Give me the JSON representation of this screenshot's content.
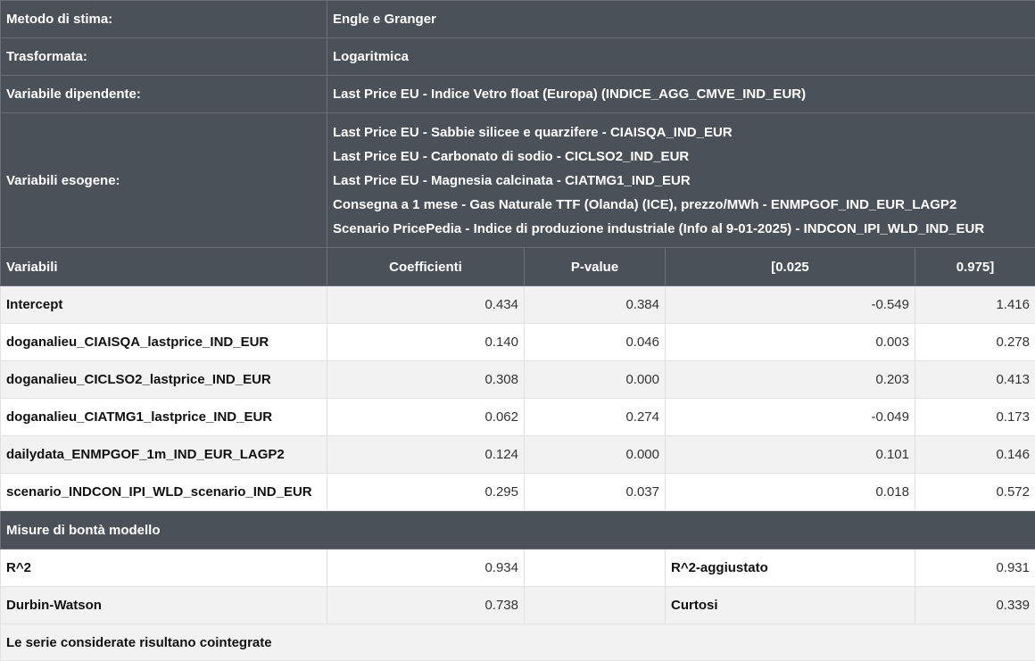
{
  "info": {
    "method": {
      "label": "Metodo di stima:",
      "value": "Engle e Granger"
    },
    "transform": {
      "label": "Trasformata:",
      "value": "Logaritmica"
    },
    "dependent": {
      "label": "Variabile dipendente:",
      "value": "Last Price EU - Indice Vetro float (Europa) (INDICE_AGG_CMVE_IND_EUR)"
    },
    "exogenous": {
      "label": "Variabili esogene:",
      "values": [
        "Last Price EU - Sabbie silicee e quarzifere - CIAISQA_IND_EUR",
        "Last Price EU - Carbonato di sodio - CICLSO2_IND_EUR",
        "Last Price EU - Magnesia calcinata - CIATMG1_IND_EUR",
        "Consegna a 1 mese - Gas Naturale TTF (Olanda) (ICE), prezzo/MWh - ENMPGOF_IND_EUR_LAGP2",
        "Scenario PricePedia - Indice di produzione industriale (Info al 9-01-2025) - INDCON_IPI_WLD_IND_EUR"
      ]
    }
  },
  "table": {
    "headers": [
      "Variabili",
      "Coefficienti",
      "P-value",
      "[0.025",
      "0.975]"
    ],
    "rows": [
      [
        "Intercept",
        "0.434",
        "0.384",
        "-0.549",
        "1.416"
      ],
      [
        "doganalieu_CIAISQA_lastprice_IND_EUR",
        "0.140",
        "0.046",
        "0.003",
        "0.278"
      ],
      [
        "doganalieu_CICLSO2_lastprice_IND_EUR",
        "0.308",
        "0.000",
        "0.203",
        "0.413"
      ],
      [
        "doganalieu_CIATMG1_lastprice_IND_EUR",
        "0.062",
        "0.274",
        "-0.049",
        "0.173"
      ],
      [
        "dailydata_ENMPGOF_1m_IND_EUR_LAGP2",
        "0.124",
        "0.000",
        "0.101",
        "0.146"
      ],
      [
        "scenario_INDCON_IPI_WLD_scenario_IND_EUR",
        "0.295",
        "0.037",
        "0.018",
        "0.572"
      ]
    ]
  },
  "goodness": {
    "title": "Misure di bontà modello",
    "rows": [
      {
        "l1": "R^2",
        "v1": "0.934",
        "l2": "R^2-aggiustato",
        "v2": "0.931"
      },
      {
        "l1": "Durbin-Watson",
        "v1": "0.738",
        "l2": "Curtosi",
        "v2": "0.339"
      }
    ]
  },
  "footer": "Le serie considerate risultano cointegrate"
}
